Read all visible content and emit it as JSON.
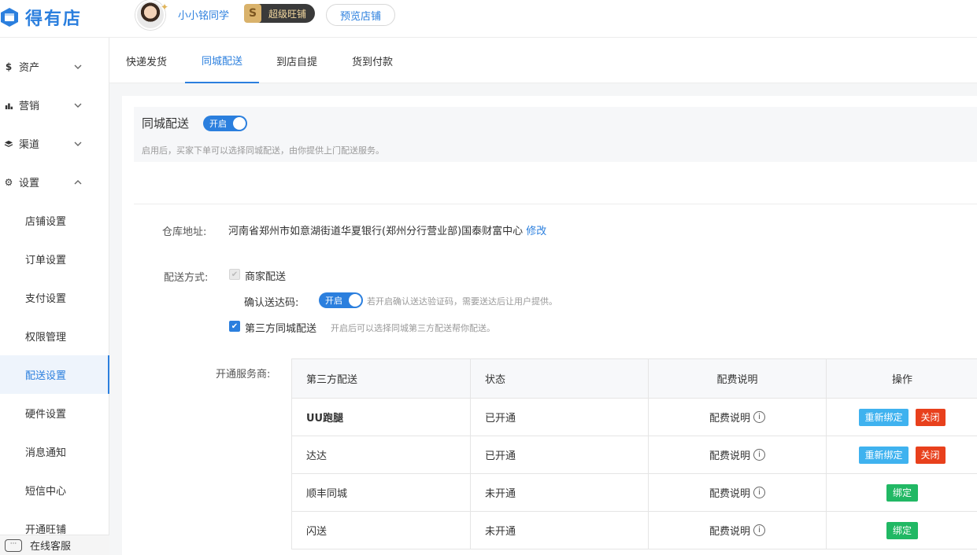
{
  "app": {
    "name": "得有店",
    "brand_color": "#2b7fde"
  },
  "header": {
    "username": "小小铭同学",
    "shop_level": "超级旺铺",
    "shop_level_icon": "S",
    "preview_label": "预览店铺"
  },
  "sidebar": {
    "groups": [
      {
        "icon": "dollar-icon",
        "glyph": "$",
        "label": "资产",
        "expanded": false
      },
      {
        "icon": "bar-chart-icon",
        "glyph": "▮",
        "label": "营销",
        "expanded": false
      },
      {
        "icon": "layers-icon",
        "glyph": "◈",
        "label": "渠道",
        "expanded": false
      },
      {
        "icon": "gear-icon",
        "glyph": "⚙",
        "label": "设置",
        "expanded": true
      }
    ],
    "sub_items": [
      "店铺设置",
      "订单设置",
      "支付设置",
      "权限管理",
      "配送设置",
      "硬件设置",
      "消息通知",
      "短信中心",
      "开通旺铺"
    ],
    "active_sub": "配送设置",
    "chat_label": "在线客服"
  },
  "tabs": [
    "快递发货",
    "同城配送",
    "到店自提",
    "货到付款"
  ],
  "active_tab": "同城配送",
  "top_card": {
    "title": "同城配送",
    "switch_label": "开启",
    "desc": "启用后，买家下单可以选择同城配送，由你提供上门配送服务。"
  },
  "warehouse": {
    "label": "仓库地址:",
    "address": "河南省郑州市如意湖街道华夏银行(郑州分行营业部)国泰财富中心",
    "edit": "修改"
  },
  "delivery": {
    "label": "配送方式:",
    "merchant": "商家配送",
    "confirm_label": "确认送达码:",
    "confirm_switch": "开启",
    "confirm_hint": "若开启确认送达验证码，需要送达后让用户提供。",
    "third_party": "第三方同城配送",
    "third_party_hint": "开启后可以选择同城第三方配送帮你配送。"
  },
  "providers": {
    "label": "开通服务商:",
    "headers": [
      "第三方配送",
      "状态",
      "配费说明",
      "操作"
    ],
    "rows": [
      {
        "name": "UU跑腿",
        "status": "已开通",
        "fee": "配费说明",
        "actions": [
          "重新绑定",
          "关闭"
        ]
      },
      {
        "name": "达达",
        "status": "已开通",
        "fee": "配费说明",
        "actions": [
          "重新绑定",
          "关闭"
        ]
      },
      {
        "name": "顺丰同城",
        "status": "未开通",
        "fee": "配费说明",
        "actions": [
          "绑定"
        ]
      },
      {
        "name": "闪送",
        "status": "未开通",
        "fee": "配费说明",
        "actions": [
          "绑定"
        ]
      }
    ]
  }
}
